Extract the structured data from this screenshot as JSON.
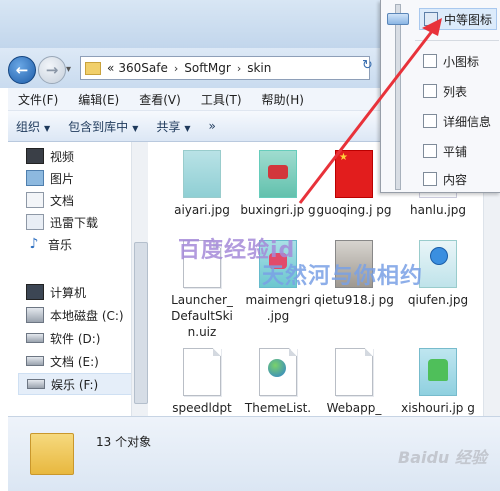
{
  "address": {
    "prefix": "«",
    "crumbs": [
      "360Safe",
      "SoftMgr",
      "skin"
    ],
    "sep": "›"
  },
  "menu": [
    "文件(F)",
    "编辑(E)",
    "查看(V)",
    "工具(T)",
    "帮助(H)"
  ],
  "toolbar": [
    {
      "label": "组织",
      "caret": true
    },
    {
      "label": "包含到库中",
      "caret": true
    },
    {
      "label": "共享",
      "caret": true
    },
    {
      "label": "»",
      "caret": false
    }
  ],
  "nav": {
    "favorites": [
      "视频",
      "图片",
      "文档",
      "迅雷下载",
      "音乐"
    ],
    "computer": "计算机",
    "drives": [
      "本地磁盘 (C:)",
      "软件 (D:)",
      "文档 (E:)",
      "娱乐 (F:)"
    ]
  },
  "files": [
    {
      "name": "aiyari.jpg",
      "kind": "thumb-teal"
    },
    {
      "name": "buxingri.jp g",
      "kind": "thumb-shoe"
    },
    {
      "name": "guoqing.j pg",
      "kind": "thumb-red"
    },
    {
      "name": "hanlu.jpg",
      "kind": "thumb-white"
    },
    {
      "name": "Launcher_ DefaultSki n.uiz",
      "kind": "doc"
    },
    {
      "name": "maimengri .jpg",
      "kind": "thumb-shoe"
    },
    {
      "name": "qietu918.j pg",
      "kind": "thumb-grey"
    },
    {
      "name": "qiufen.jpg",
      "kind": "thumb-doraemon"
    },
    {
      "name": "speedldpt skin.uiz",
      "kind": "doc"
    },
    {
      "name": "ThemeList. xml",
      "kind": "xml"
    },
    {
      "name": "Webapp_ DefaultSki",
      "kind": "doc"
    },
    {
      "name": "xishouri.jp g",
      "kind": "thumb-green"
    }
  ],
  "status": {
    "count": "13 个对象"
  },
  "view_menu": {
    "items": [
      "中等图标",
      "小图标",
      "列表",
      "详细信息",
      "平铺",
      "内容"
    ],
    "selected": "中等图标",
    "slider_level": 0.05
  },
  "watermark": {
    "line1": "百度经验id",
    "line2": "天然河与你相约",
    "logo": "Baidu 经验"
  },
  "colors": {
    "accent": "#3b6fb0",
    "arrow": "#e8323a"
  }
}
